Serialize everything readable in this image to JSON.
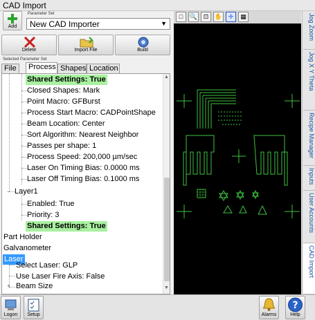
{
  "window": {
    "title": "CAD Import"
  },
  "top": {
    "add_label": "Add",
    "parameter_set_label": "Parameter Set",
    "parameter_set_value": "New CAD Importer",
    "selected_parameter_set_label": "Selected Parameter Set"
  },
  "toolbar": {
    "delete_label": "Delete",
    "import_label": "Import File",
    "build_label": "Build"
  },
  "tabs": [
    "File",
    "Process",
    "Shapes",
    "Location"
  ],
  "tree": {
    "shared_settings_1": "Shared Settings: True",
    "closed_shapes": "Closed Shapes: Mark",
    "point_macro": "Point Macro: GFBurst",
    "process_start_macro": "Process Start Macro: CADPointShape",
    "beam_location": "Beam Location: Center",
    "sort_algorithm": "Sort Algorithm: Nearest Neighbor",
    "passes": "Passes per shape: 1",
    "process_speed": "Process Speed: 200,000 µm/sec",
    "laser_on_bias": "Laser On Timing Bias: 0.0000 ms",
    "laser_off_bias": "Laser Off Timing Bias: 0.1000 ms",
    "layer1": "Layer1",
    "enabled": "Enabled: True",
    "priority": "Priority: 3",
    "shared_settings_2": "Shared Settings: True",
    "part_holder": "Part Holder",
    "galvanometer": "Galvanometer",
    "laser": "Laser",
    "select_laser": "Select Laser: GLP",
    "use_laser_fire_axis": "Use Laser Fire Axis: False",
    "beam_size": "Beam Size"
  },
  "sidebar": [
    "Jog Zoom",
    "Jog X Y Theta",
    "Recipe Manager",
    "Inputs",
    "User Accounts",
    "CAD Import"
  ],
  "bottom": {
    "logon_label": "Logon",
    "setup_label": "Setup",
    "alarms_label": "Alarms",
    "help_label": "Help"
  },
  "colors": {
    "selection": "#3399ff",
    "highlight": "#a8f0a0",
    "cad_green": "#3ec43e",
    "link": "#1a4fa0"
  }
}
